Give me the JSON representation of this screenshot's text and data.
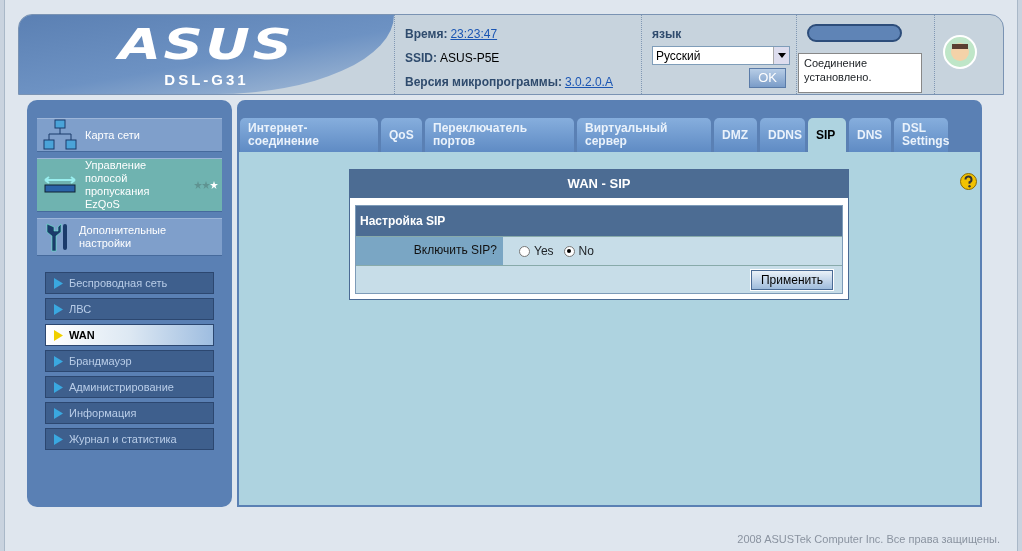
{
  "header": {
    "logo": "ASUS",
    "model": "DSL-G31",
    "time_label": "Время:",
    "time": "23:23:47",
    "ssid_label": "SSID:",
    "ssid": "ASUS-P5E",
    "firmware_label": "Версия микропрограммы:",
    "firmware": "3.0.2.0.A",
    "language_label": "язык",
    "language": "Русский",
    "ok_button": "OK",
    "tooltip": "Соединение установлено."
  },
  "sidebar": {
    "sections": [
      {
        "kind": "network",
        "label": "Карта сети",
        "selected": false
      },
      {
        "kind": "bandwidth",
        "label": "Управление полосой пропускания EzQoS",
        "selected": true,
        "stars": 1
      },
      {
        "kind": "tools",
        "label": "Дополнительные настройки",
        "selected": false
      }
    ],
    "menu": [
      {
        "label": "Беспроводная сеть",
        "selected": false
      },
      {
        "label": "ЛВС",
        "selected": false
      },
      {
        "label": "WAN",
        "selected": true
      },
      {
        "label": "Брандмауэр",
        "selected": false
      },
      {
        "label": "Администрирование",
        "selected": false
      },
      {
        "label": "Информация",
        "selected": false
      },
      {
        "label": "Журнал и статистика",
        "selected": false
      }
    ]
  },
  "tabs": [
    {
      "label": "Интернет-соединение",
      "selected": false
    },
    {
      "label": "QoS",
      "selected": false
    },
    {
      "label": "Переключатель портов",
      "selected": false
    },
    {
      "label": "Виртуальный сервер",
      "selected": false
    },
    {
      "label": "DMZ",
      "selected": false
    },
    {
      "label": "DDNS",
      "selected": false
    },
    {
      "label": "SIP",
      "selected": true
    },
    {
      "label": "DNS",
      "selected": false
    },
    {
      "label": "DSL Settings",
      "selected": false
    }
  ],
  "form": {
    "title": "WAN - SIP",
    "section": "Настройка SIP",
    "field_label": "Включить SIP?",
    "options": [
      {
        "label": "Yes",
        "selected": false
      },
      {
        "label": "No",
        "selected": true
      }
    ],
    "apply_button": "Применить"
  },
  "footer": "2008 ASUSTek Computer Inc. Все права защищены."
}
